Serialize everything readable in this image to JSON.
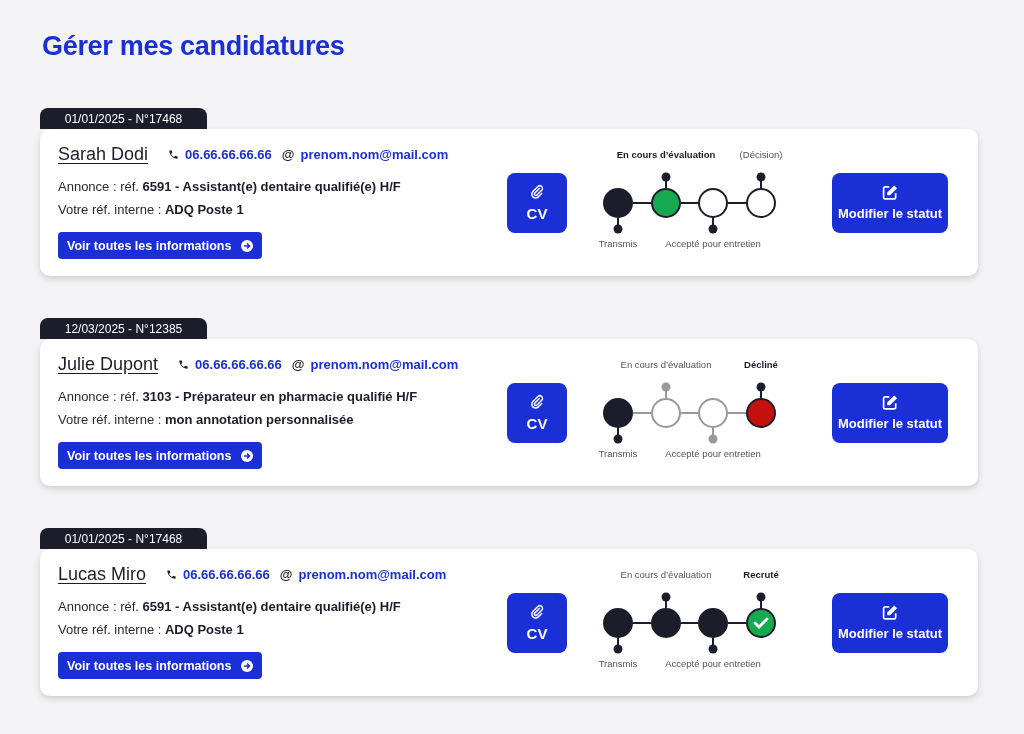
{
  "title": "Gérer mes candidatures",
  "applications": [
    {
      "tag": "01/01/2025 - N°17468",
      "name": "Sarah Dodi",
      "phone": "06.66.66.66.66",
      "at_sign": "@",
      "email": "prenom.nom@mail.com",
      "annonce": "Annonce : réf. **6591 - Assistant(e) dentaire qualifié(e) H/F**",
      "internal_ref": "Votre réf. interne : **ADQ Poste 1**",
      "details_button": "Voir toutes les informations",
      "cv_button": "CV",
      "status_button": "Modifier le statut",
      "steps": [
        {
          "label": "Transmis",
          "kind": "done"
        },
        {
          "label": "En cours d’évaluation",
          "kind": "current"
        },
        {
          "label": "Accepté pour entretien",
          "kind": "pending"
        },
        {
          "label": "(Décision)",
          "kind": "pending"
        }
      ]
    },
    {
      "tag": "12/03/2025 - N°12385",
      "name": "Julie Dupont",
      "phone": "06.66.66.66.66",
      "at_sign": "@",
      "email": "prenom.nom@mail.com",
      "annonce": "Annonce : réf. **3103 - Préparateur en pharmacie qualifié H/F**",
      "internal_ref": "Votre réf. interne : **mon annotation personnalisée**",
      "details_button": "Voir toutes les informations",
      "cv_button": "CV",
      "status_button": "Modifier le statut",
      "steps": [
        {
          "label": "Transmis",
          "kind": "done"
        },
        {
          "label": "En cours d’évaluation",
          "kind": "skipped"
        },
        {
          "label": "Accepté pour entretien",
          "kind": "skipped"
        },
        {
          "label": "Décliné",
          "kind": "declined"
        }
      ]
    },
    {
      "tag": "01/01/2025 - N°17468",
      "name": "Lucas Miro",
      "phone": "06.66.66.66.66",
      "at_sign": "@",
      "email": "prenom.nom@mail.com",
      "annonce": "Annonce : réf. **6591 - Assistant(e) dentaire qualifié(e) H/F**",
      "internal_ref": "Votre réf. interne : **ADQ Poste 1**",
      "details_button": "Voir toutes les informations",
      "cv_button": "CV",
      "status_button": "Modifier le statut",
      "steps": [
        {
          "label": "Transmis",
          "kind": "done"
        },
        {
          "label": "En cours d’évaluation",
          "kind": "done"
        },
        {
          "label": "Accepté pour entretien",
          "kind": "done"
        },
        {
          "label": "Recruté",
          "kind": "recruited"
        }
      ]
    }
  ]
}
